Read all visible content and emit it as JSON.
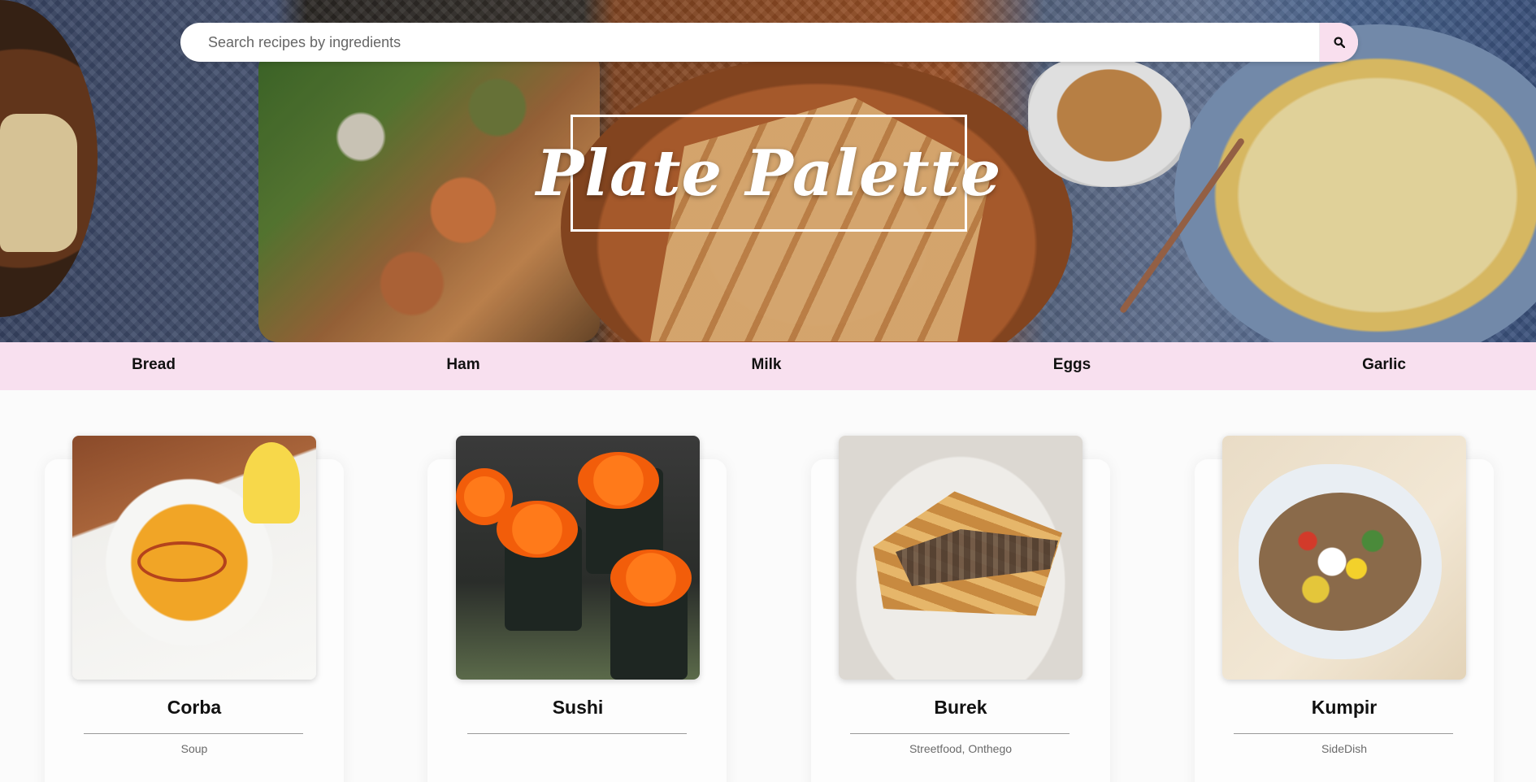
{
  "search": {
    "placeholder": "Search recipes by ingredients",
    "button_icon": "search-icon"
  },
  "brand": {
    "title": "Plate Palette"
  },
  "colors": {
    "nav_background": "#f8e0ef",
    "search_button_background": "#f9dfee",
    "brand_text": "#ffffff"
  },
  "ingredients": [
    {
      "label": "Bread"
    },
    {
      "label": "Ham"
    },
    {
      "label": "Milk"
    },
    {
      "label": "Eggs"
    },
    {
      "label": "Garlic"
    }
  ],
  "recipes": [
    {
      "title": "Corba",
      "category": "Soup",
      "image": "corba-image"
    },
    {
      "title": "Sushi",
      "category": "",
      "image": "sushi-image"
    },
    {
      "title": "Burek",
      "category": "Streetfood, Onthego",
      "image": "burek-image"
    },
    {
      "title": "Kumpir",
      "category": "SideDish",
      "image": "kumpir-image"
    }
  ]
}
